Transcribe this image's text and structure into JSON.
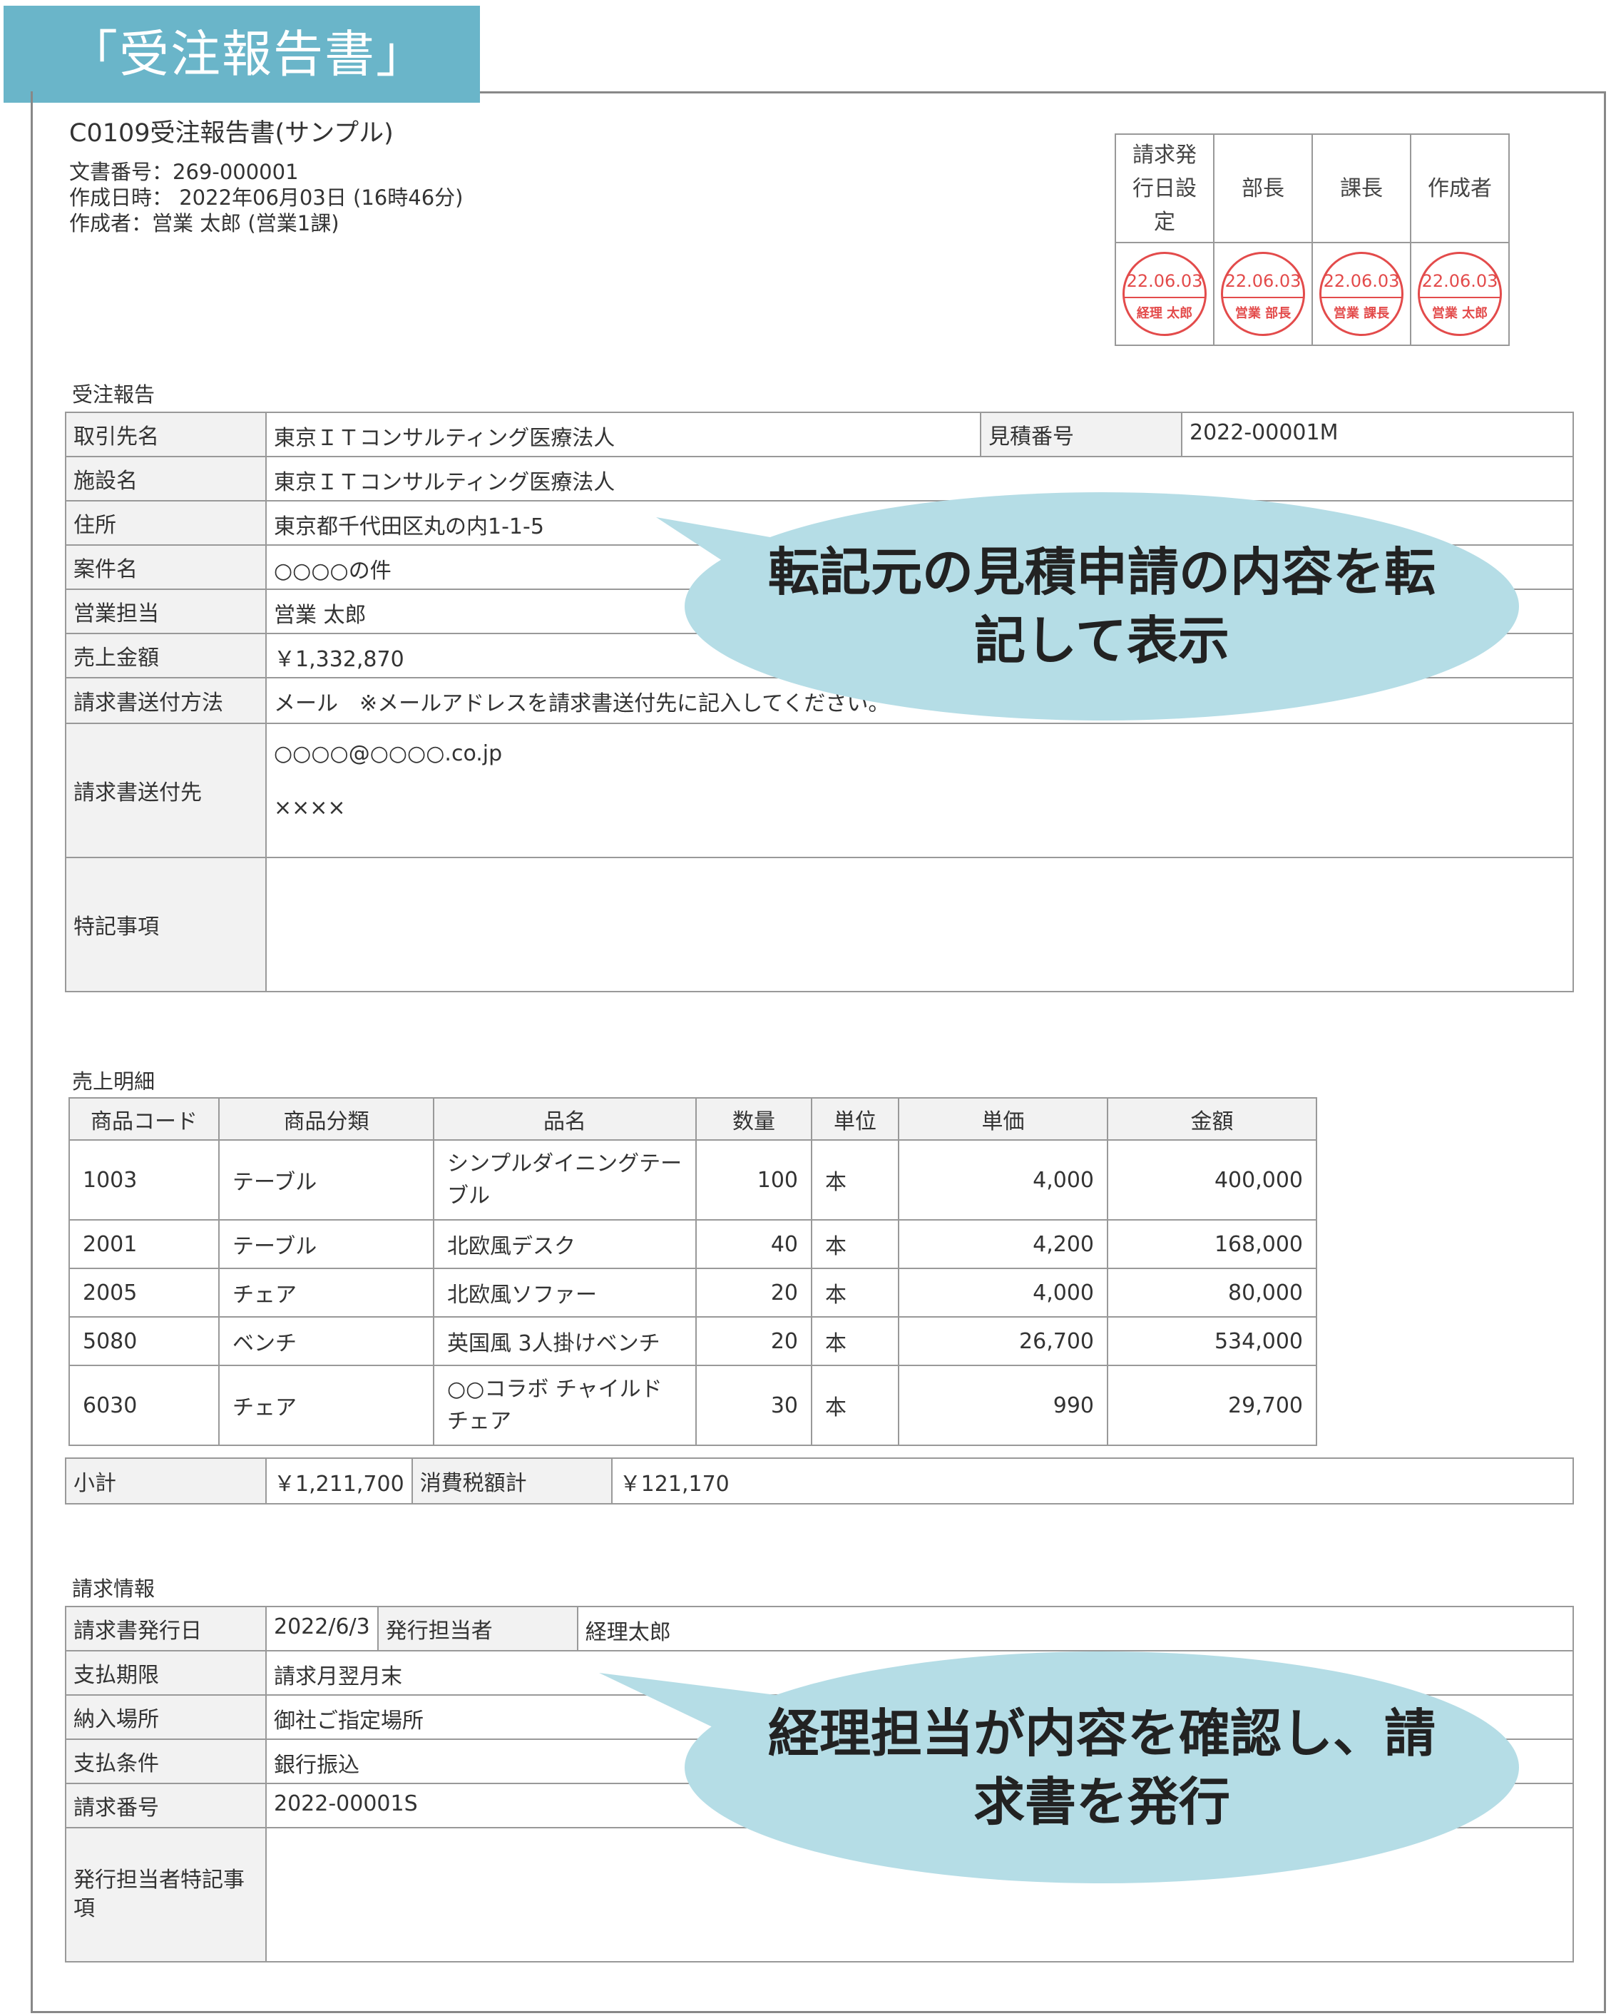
{
  "banner": "「受注報告書」",
  "document": {
    "title": "C0109受注報告書(サンプル)",
    "doc_number": "文書番号：269-000001",
    "created_at": "作成日時： 2022年06月03日 (16時46分)",
    "author": "作成者：営業 太郎 (営業1課)"
  },
  "approvals": [
    {
      "role": "請求発行日設定",
      "date": "22.06.03",
      "name": "経理 太郎"
    },
    {
      "role": "部長",
      "date": "22.06.03",
      "name": "営業 部長"
    },
    {
      "role": "課長",
      "date": "22.06.03",
      "name": "営業 課長"
    },
    {
      "role": "作成者",
      "date": "22.06.03",
      "name": "営業 太郎"
    }
  ],
  "order_report": {
    "section": "受注報告",
    "client_label": "取引先名",
    "client": "東京ＩＴコンサルティング医療法人",
    "estimate_label": "見積番号",
    "estimate": "2022-00001M",
    "facility_label": "施設名",
    "facility": "東京ＩＴコンサルティング医療法人",
    "address_label": "住所",
    "address": "東京都千代田区丸の内1-1-5",
    "case_label": "案件名",
    "case": "○○○○の件",
    "sales_label": "営業担当",
    "sales": "営業 太郎",
    "amount_label": "売上金額",
    "amount": "￥1,332,870",
    "send_method_label": "請求書送付方法",
    "send_method": "メール　※メールアドレスを請求書送付先に記入してください。",
    "send_to_label": "請求書送付先",
    "send_to_1": "○○○○@○○○○.co.jp",
    "send_to_2": "××××",
    "notes_label": "特記事項",
    "notes": ""
  },
  "sales_detail": {
    "section": "売上明細",
    "headers": [
      "商品コード",
      "商品分類",
      "品名",
      "数量",
      "単位",
      "単価",
      "金額"
    ],
    "rows": [
      [
        "1003",
        "テーブル",
        "シンプルダイニングテーブル",
        "100",
        "本",
        "4,000",
        "400,000"
      ],
      [
        "2001",
        "テーブル",
        "北欧風デスク",
        "40",
        "本",
        "4,200",
        "168,000"
      ],
      [
        "2005",
        "チェア",
        "北欧風ソファー",
        "20",
        "本",
        "4,000",
        "80,000"
      ],
      [
        "5080",
        "ベンチ",
        "英国風 3人掛けベンチ",
        "20",
        "本",
        "26,700",
        "534,000"
      ],
      [
        "6030",
        "チェア",
        "○○コラボ チャイルドチェア",
        "30",
        "本",
        "990",
        "29,700"
      ]
    ],
    "subtotal_label": "小計",
    "subtotal": "￥1,211,700",
    "tax_label": "消費税額計",
    "tax": "￥121,170"
  },
  "billing": {
    "section": "請求情報",
    "issue_date_label": "請求書発行日",
    "issue_date": "2022/6/3",
    "issuer_label": "発行担当者",
    "issuer": "経理太郎",
    "due_label": "支払期限",
    "due": "請求月翌月末",
    "place_label": "納入場所",
    "place": "御社ご指定場所",
    "terms_label": "支払条件",
    "terms": "銀行振込",
    "invoice_no_label": "請求番号",
    "invoice_no": "2022-00001S",
    "issuer_notes_label": "発行担当者特記事項",
    "issuer_notes": ""
  },
  "callouts": {
    "top": "転記元の見積申請の内容を転記して表示",
    "bottom": "経理担当が内容を確認し、請求書を発行"
  },
  "colors": {
    "banner": "#6ab5c9",
    "callout": "#b5dde6",
    "stamp": "#e34b4b",
    "label_bg": "#f2f2f2"
  }
}
